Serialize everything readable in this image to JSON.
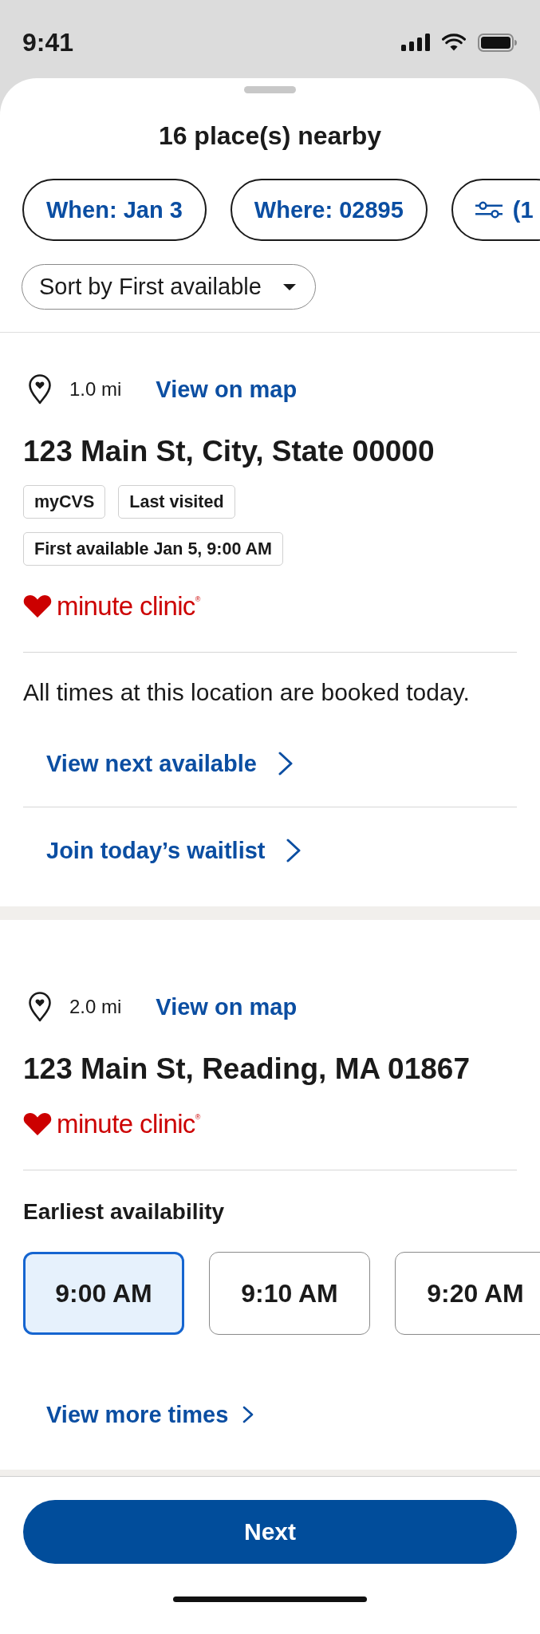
{
  "status_bar": {
    "time": "9:41"
  },
  "sheet": {
    "title": "16 place(s) nearby",
    "filters": [
      {
        "kind": "text",
        "label": "When: Jan 3"
      },
      {
        "kind": "text",
        "label": "Where: 02895"
      },
      {
        "kind": "icon",
        "label": "(1"
      }
    ],
    "sort": {
      "label": "Sort by First available"
    }
  },
  "locations": [
    {
      "distance": "1.0 mi",
      "map_link": "View on map",
      "address": "123 Main St, City, State 00000",
      "badges": [
        "myCVS",
        "Last visited"
      ],
      "first_available": "First available Jan 5, 9:00 AM",
      "brand": "minute clinic$^{®}$",
      "message": "All times at this location are booked today.",
      "actions": [
        "View next available",
        "Join today’s waitlist"
      ]
    },
    {
      "distance": "2.0 mi",
      "map_link": "View on map",
      "address": "123 Main St, Reading, MA 01867",
      "brand": "minute clinic$^{®}$",
      "availability": {
        "title": "Earliest availability",
        "slots": [
          {
            "time": "9:00 AM",
            "selected": true
          },
          {
            "time": "9:10 AM",
            "selected": false
          },
          {
            "time": "9:20 AM",
            "selected": false
          }
        ],
        "more_link": "View more times"
      }
    }
  ],
  "footer": {
    "button": "Next"
  }
}
